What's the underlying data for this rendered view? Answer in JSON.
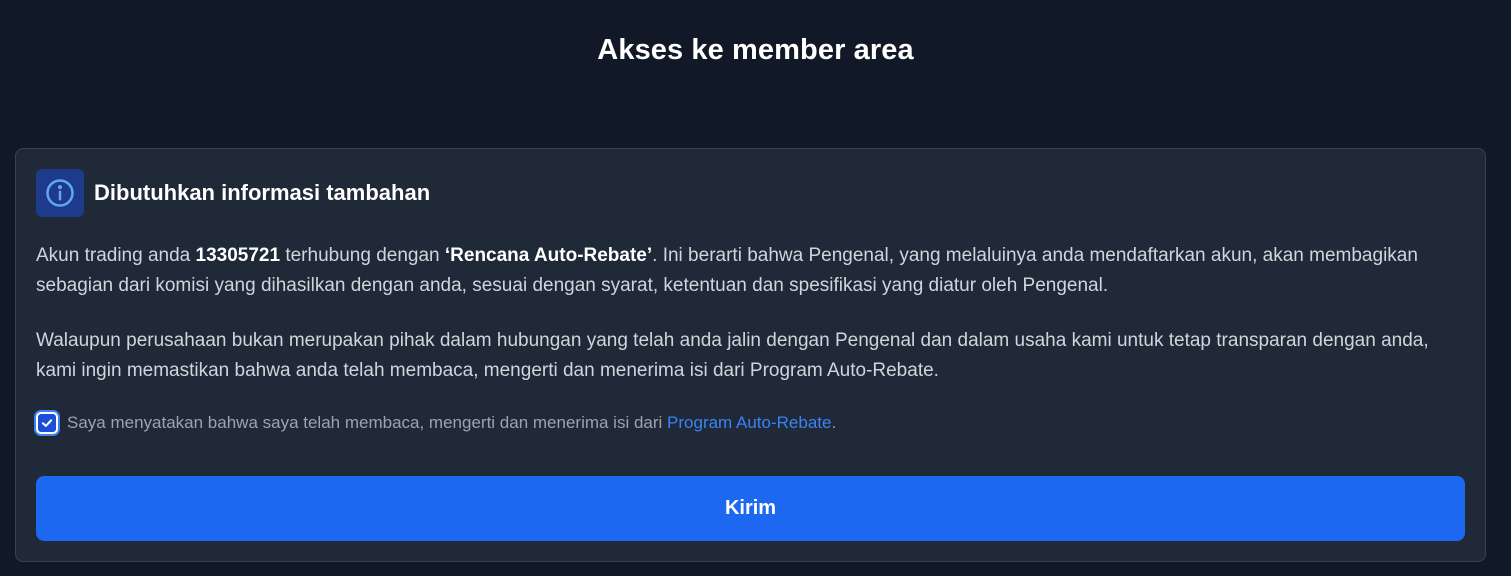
{
  "page": {
    "title": "Akses ke member area"
  },
  "card": {
    "title": "Dibutuhkan informasi tambahan",
    "icon": "info-icon",
    "paragraph1": {
      "prefix": "Akun trading anda ",
      "account_number": "13305721",
      "middle": " terhubung dengan ",
      "plan_name": "‘Rencana Auto-Rebate’",
      "suffix": ". Ini berarti bahwa Pengenal, yang melaluinya anda mendaftarkan akun, akan membagikan sebagian dari komisi yang dihasilkan dengan anda, sesuai dengan syarat, ketentuan dan spesifikasi yang diatur oleh Pengenal."
    },
    "paragraph2": "Walaupun perusahaan bukan merupakan pihak dalam hubungan yang telah anda jalin dengan Pengenal dan dalam usaha kami untuk tetap transparan dengan anda, kami ingin memastikan bahwa anda telah membaca, mengerti dan menerima isi dari Program Auto-Rebate.",
    "consent": {
      "checked": true,
      "text": "Saya menyatakan bahwa saya telah membaca, mengerti dan menerima isi dari ",
      "link_text": "Program Auto-Rebate",
      "end": "."
    },
    "submit_label": "Kirim"
  },
  "colors": {
    "background": "#111827",
    "card": "#1f2937",
    "accent": "#1d68f0",
    "link": "#3b82f6"
  }
}
